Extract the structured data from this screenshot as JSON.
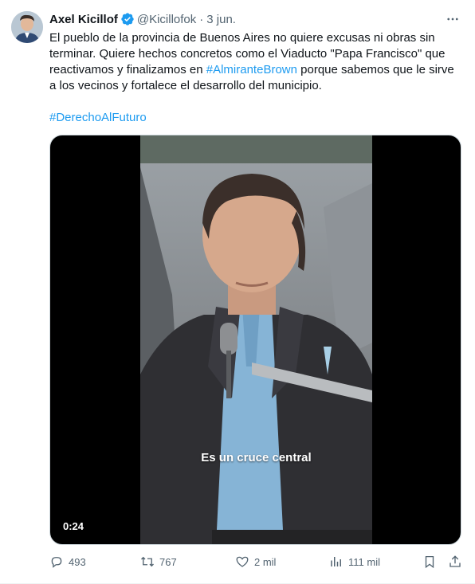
{
  "tweet": {
    "author_name": "Axel Kicillof",
    "handle": "@Kicillofok",
    "separator": "·",
    "date": "3 jun.",
    "text_part1": "El pueblo de la provincia de Buenos Aires no quiere excusas ni obras sin terminar. Quiere hechos concretos como el Viaducto \"Papa Francisco\" que reactivamos y finalizamos en ",
    "hashtag_inline": "#AlmiranteBrown",
    "text_part2": " porque sabemos que le sirve a los vecinos y fortalece el desarrollo del municipio.",
    "hashtag_bottom": "#DerechoAlFuturo"
  },
  "media": {
    "caption": "Es un cruce central",
    "duration": "0:24"
  },
  "actions": {
    "replies": "493",
    "retweets": "767",
    "likes": "2 mil",
    "views": "111 mil"
  },
  "colors": {
    "link": "#1d9bf0",
    "verified": "#1d9bf0",
    "muted": "#536471"
  },
  "icons": [
    "more-icon",
    "verified-icon",
    "reply-icon",
    "retweet-icon",
    "like-icon",
    "views-icon",
    "bookmark-icon",
    "share-icon"
  ]
}
